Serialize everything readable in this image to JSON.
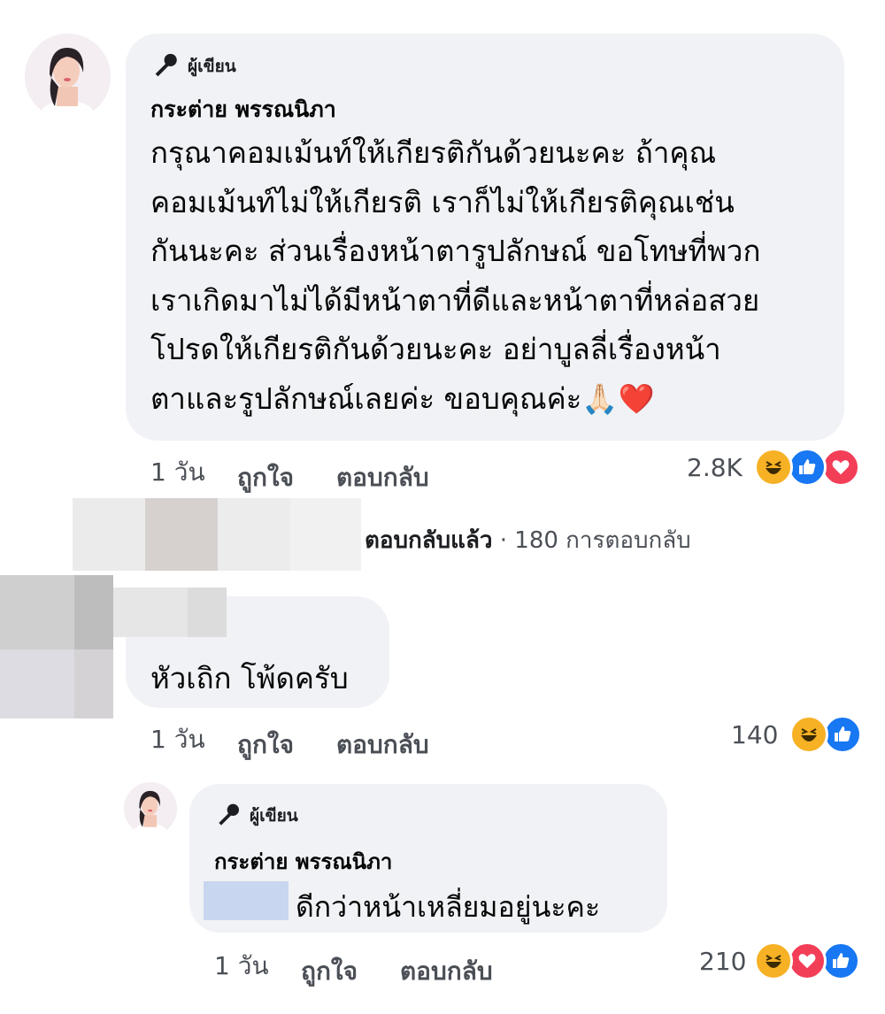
{
  "comment1": {
    "badge": "ผู้เขียน",
    "author": "กระต่าย พรรณนิภา",
    "lines": [
      "กรุณาคอมเม้นท์ให้เกียรติกันด้วยนะคะ ถ้าคุณ",
      "คอมเม้นท์ไม่ให้เกียรติ เราก็ไม่ให้เกียรติคุณเช่น",
      "กันนะคะ ส่วนเรื่องหน้าตารูปลักษณ์ ขอโทษที่พวก",
      "เราเกิดมาไม่ได้มีหน้าตาที่ดีและหน้าตาที่หล่อสวย",
      "โปรดให้เกียรติกันด้วยนะคะ อย่าบูลลี่เรื่องหน้า",
      "ตาและรูปลักษณ์เลยค่ะ ขอบคุณค่ะ🙏🏻❤️"
    ],
    "time": "1 วัน",
    "like": "ถูกใจ",
    "reply": "ตอบกลับ",
    "reaction_count": "2.8K",
    "reactions": [
      "haha-icon",
      "like-icon",
      "love-icon"
    ]
  },
  "replies_summary": {
    "replied": "ตอบกลับแล้ว",
    "sep": "·",
    "count": "180 การตอบกลับ"
  },
  "comment2": {
    "text": "หัวเถิก โพ้ดครับ",
    "time": "1 วัน",
    "like": "ถูกใจ",
    "reply": "ตอบกลับ",
    "reaction_count": "140",
    "reactions": [
      "haha-icon",
      "like-icon"
    ]
  },
  "comment3": {
    "badge": "ผู้เขียน",
    "author": "กระต่าย พรรณนิภา",
    "text": "ดีกว่าหน้าเหลี่ยมอยู่นะคะ",
    "time": "1 วัน",
    "like": "ถูกใจ",
    "reply": "ตอบกลับ",
    "reaction_count": "210",
    "reactions": [
      "haha-icon",
      "love-icon",
      "like-icon"
    ]
  },
  "colors": {
    "bubble": "#f0f2f5",
    "like_blue": "#1877f2",
    "love_red": "#f33e58",
    "haha_yellow": "#f7b125"
  }
}
